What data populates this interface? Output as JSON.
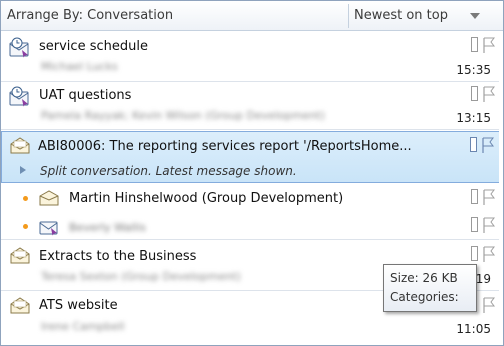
{
  "header": {
    "arrange_label": "Arrange By: Conversation",
    "sort_label": "Newest on top"
  },
  "messages": [
    {
      "subject": "service schedule",
      "sender": "Michael Lucks",
      "time": "15:35"
    },
    {
      "subject": "UAT questions",
      "sender": "Pamela Rayyak; Kevin Wilson (Group Development)",
      "time": "13:15"
    },
    {
      "subject": "ABI80006: The reporting services report '/ReportsHome...",
      "split_note": "Split conversation. Latest message shown."
    },
    {
      "subject": "Extracts to the Business",
      "sender": "Teresa Sexton (Group Development)",
      "time": "11:19"
    },
    {
      "subject": "ATS website",
      "sender": "Irene Campbell",
      "time": "11:05"
    }
  ],
  "conversation_children": [
    {
      "name": "Martin Hinshelwood (Group Development)"
    },
    {
      "name": "Beverly Wallis"
    }
  ],
  "tooltip": {
    "size": "Size: 26 KB",
    "categories": "Categories:"
  },
  "colors": {
    "selection_bg": "#c9e4f8",
    "selection_border": "#84acdd",
    "unread_dot": "#f39a1c"
  }
}
